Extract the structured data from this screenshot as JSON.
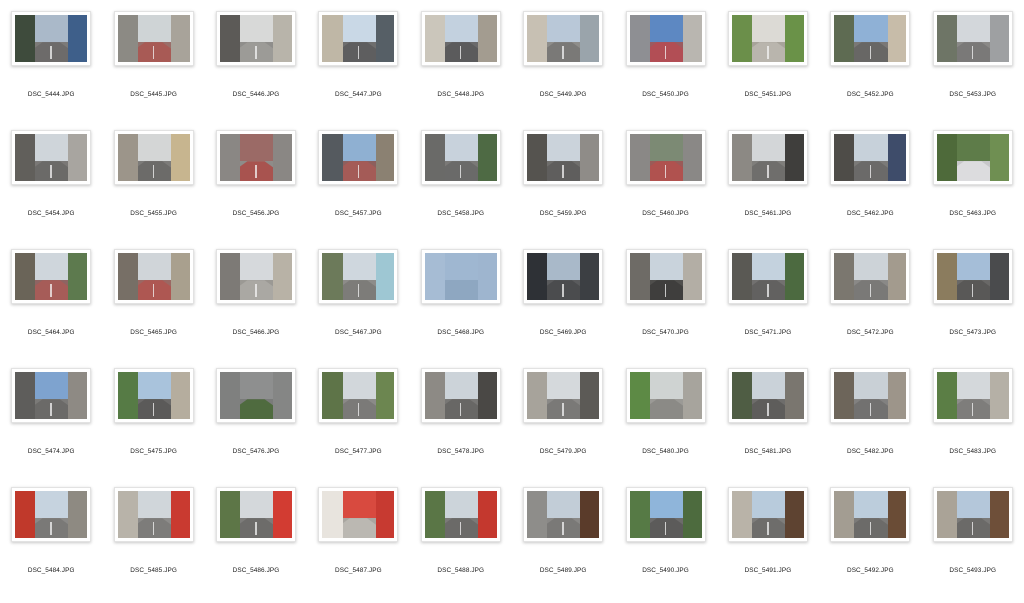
{
  "files": [
    {
      "name": "DSC_5444.JPG",
      "scene": "street",
      "palette": {
        "sky": "#aab9c9",
        "left": "#3e4b3c",
        "right": "#3e5f8a",
        "ground": "#7c7a78",
        "road": "#6d6b6a"
      }
    },
    {
      "name": "DSC_5445.JPG",
      "scene": "street",
      "palette": {
        "sky": "#cfd4d6",
        "left": "#8c8a84",
        "right": "#a8a39a",
        "ground": "#9a6e69",
        "road": "#a85a55"
      }
    },
    {
      "name": "DSC_5446.JPG",
      "scene": "street",
      "palette": {
        "sky": "#d8d9d8",
        "left": "#5c5a57",
        "right": "#b8b4aa",
        "ground": "#8f8e8b",
        "road": "#9c9b97"
      }
    },
    {
      "name": "DSC_5447.JPG",
      "scene": "street",
      "palette": {
        "sky": "#c9d8e6",
        "left": "#bfb7a6",
        "right": "#565f66",
        "ground": "#6e6e6e",
        "road": "#5e5e5f"
      }
    },
    {
      "name": "DSC_5448.JPG",
      "scene": "street",
      "palette": {
        "sky": "#c3d1df",
        "left": "#cbc6bb",
        "right": "#a39c90",
        "ground": "#6a6a6b",
        "road": "#5b5b5c"
      }
    },
    {
      "name": "DSC_5449.JPG",
      "scene": "street",
      "palette": {
        "sky": "#b9c8d8",
        "left": "#c7c0b3",
        "right": "#9aa4ab",
        "ground": "#8e8d8a",
        "road": "#7a7977"
      }
    },
    {
      "name": "DSC_5450.JPG",
      "scene": "street",
      "palette": {
        "sky": "#5d88c2",
        "left": "#8e8f93",
        "right": "#b9b6b0",
        "ground": "#9b5b5f",
        "road": "#b24e55"
      }
    },
    {
      "name": "DSC_5451.JPG",
      "scene": "street",
      "palette": {
        "sky": "#dcdad5",
        "left": "#6b8f4a",
        "right": "#6a9248",
        "ground": "#a7a39a",
        "road": "#b9b5ad"
      }
    },
    {
      "name": "DSC_5452.JPG",
      "scene": "street",
      "palette": {
        "sky": "#8fb1d6",
        "left": "#5e6b52",
        "right": "#c7bca9",
        "ground": "#7a7876",
        "road": "#686765"
      }
    },
    {
      "name": "DSC_5453.JPG",
      "scene": "street",
      "palette": {
        "sky": "#d3d7db",
        "left": "#6e7566",
        "right": "#9ea0a2",
        "ground": "#8a8987",
        "road": "#7a7978"
      }
    },
    {
      "name": "DSC_5454.JPG",
      "scene": "street",
      "palette": {
        "sky": "#cfd5da",
        "left": "#615f5b",
        "right": "#a8a5a0",
        "ground": "#7a7876",
        "road": "#6b6a68"
      }
    },
    {
      "name": "DSC_5455.JPG",
      "scene": "street",
      "palette": {
        "sky": "#d4d6d6",
        "left": "#9c958a",
        "right": "#c7b58f",
        "ground": "#7c7b79",
        "road": "#6c6b69"
      }
    },
    {
      "name": "DSC_5456.JPG",
      "scene": "road",
      "palette": {
        "sky": "#9b6a66",
        "left": "#8a8784",
        "right": "#8a8784",
        "ground": "#8e8c89",
        "road": "#a8534f"
      }
    },
    {
      "name": "DSC_5457.JPG",
      "scene": "street",
      "palette": {
        "sky": "#8fb0d2",
        "left": "#555a5f",
        "right": "#8b8172",
        "ground": "#8d5f5d",
        "road": "#a45b57"
      }
    },
    {
      "name": "DSC_5458.JPG",
      "scene": "street",
      "palette": {
        "sky": "#c8d2dc",
        "left": "#6a6a68",
        "right": "#4e6a44",
        "ground": "#7a7977",
        "road": "#6a6a69"
      }
    },
    {
      "name": "DSC_5459.JPG",
      "scene": "street",
      "palette": {
        "sky": "#cbd3db",
        "left": "#55534f",
        "right": "#8f8c88",
        "ground": "#6f6e6c",
        "road": "#5f5e5d"
      }
    },
    {
      "name": "DSC_5460.JPG",
      "scene": "road",
      "palette": {
        "sky": "#7c8a74",
        "left": "#8a8886",
        "right": "#8a8886",
        "ground": "#9a5b58",
        "road": "#b0524f"
      }
    },
    {
      "name": "DSC_5461.JPG",
      "scene": "street",
      "palette": {
        "sky": "#d3d6d8",
        "left": "#8c8984",
        "right": "#3f3e3c",
        "ground": "#7f7e7b",
        "road": "#6f6e6c"
      }
    },
    {
      "name": "DSC_5462.JPG",
      "scene": "street",
      "palette": {
        "sky": "#c7d1da",
        "left": "#4e4c48",
        "right": "#3e4c6a",
        "ground": "#7b7a78",
        "road": "#6b6a69"
      }
    },
    {
      "name": "DSC_5463.JPG",
      "scene": "plants",
      "palette": {
        "sky": "#5e7c49",
        "left": "#4e6a3a",
        "right": "#6f8f52",
        "ground": "#c7c7c9",
        "road": "#dcdcde"
      }
    },
    {
      "name": "DSC_5464.JPG",
      "scene": "street",
      "palette": {
        "sky": "#cfd6dc",
        "left": "#6a6458",
        "right": "#5d7a4e",
        "ground": "#8e6462",
        "road": "#a65c58"
      }
    },
    {
      "name": "DSC_5465.JPG",
      "scene": "street",
      "palette": {
        "sky": "#d0d5d9",
        "left": "#776f66",
        "right": "#a9a08e",
        "ground": "#9a6863",
        "road": "#ae5752"
      }
    },
    {
      "name": "DSC_5466.JPG",
      "scene": "street",
      "palette": {
        "sky": "#d6d9dc",
        "left": "#7d7a76",
        "right": "#b8b2a6",
        "ground": "#9b9994",
        "road": "#aaa8a3"
      }
    },
    {
      "name": "DSC_5467.JPG",
      "scene": "street",
      "palette": {
        "sky": "#cfd7de",
        "left": "#6c7a5a",
        "right": "#9ec7d3",
        "ground": "#8d8c89",
        "road": "#7d7c79"
      }
    },
    {
      "name": "DSC_5468.JPG",
      "scene": "sky",
      "palette": {
        "sky": "#9fb7d1",
        "left": "#a6bcd4",
        "right": "#9eb5cf",
        "ground": "#8ea7c1",
        "road": "#8ea7c1"
      }
    },
    {
      "name": "DSC_5469.JPG",
      "scene": "street",
      "palette": {
        "sky": "#a9b9c9",
        "left": "#2e3136",
        "right": "#3c3f43",
        "ground": "#5a5b5d",
        "road": "#4b4c4e"
      }
    },
    {
      "name": "DSC_5470.JPG",
      "scene": "street",
      "palette": {
        "sky": "#c9d3dc",
        "left": "#6e6b66",
        "right": "#b3aea5",
        "ground": "#4f4e4c",
        "road": "#3f3e3d"
      }
    },
    {
      "name": "DSC_5471.JPG",
      "scene": "street",
      "palette": {
        "sky": "#c4d2de",
        "left": "#5a5954",
        "right": "#4c6a40",
        "ground": "#727170",
        "road": "#626160"
      }
    },
    {
      "name": "DSC_5472.JPG",
      "scene": "street",
      "palette": {
        "sky": "#cdd3d8",
        "left": "#7b776f",
        "right": "#a39b8e",
        "ground": "#8a8987",
        "road": "#7a7977"
      }
    },
    {
      "name": "DSC_5473.JPG",
      "scene": "street",
      "palette": {
        "sky": "#a5bed8",
        "left": "#8b7c5e",
        "right": "#4a4b4d",
        "ground": "#696867",
        "road": "#595857"
      }
    },
    {
      "name": "DSC_5474.JPG",
      "scene": "street",
      "palette": {
        "sky": "#7ea3cf",
        "left": "#5e5d5b",
        "right": "#8e8a84",
        "ground": "#7b7a78",
        "road": "#6b6a68"
      }
    },
    {
      "name": "DSC_5475.JPG",
      "scene": "street",
      "palette": {
        "sky": "#a9c3dc",
        "left": "#567b45",
        "right": "#b5ad9e",
        "ground": "#6b6a69",
        "road": "#5b5a59"
      }
    },
    {
      "name": "DSC_5476.JPG",
      "scene": "wall",
      "palette": {
        "sky": "#8e8f8f",
        "left": "#7f807f",
        "right": "#858685",
        "ground": "#7a7b7a",
        "road": "#4f6b3f"
      }
    },
    {
      "name": "DSC_5477.JPG",
      "scene": "street",
      "palette": {
        "sky": "#d2d7db",
        "left": "#5e7448",
        "right": "#6c8650",
        "ground": "#8b8a88",
        "road": "#7b7a78"
      }
    },
    {
      "name": "DSC_5478.JPG",
      "scene": "street",
      "palette": {
        "sky": "#ccd3d9",
        "left": "#8d8a85",
        "right": "#4a4845",
        "ground": "#787775",
        "road": "#686765"
      }
    },
    {
      "name": "DSC_5479.JPG",
      "scene": "street",
      "palette": {
        "sky": "#d5d9dc",
        "left": "#a7a39b",
        "right": "#5c5a56",
        "ground": "#8a8987",
        "road": "#7a7977"
      }
    },
    {
      "name": "DSC_5480.JPG",
      "scene": "plants",
      "palette": {
        "sky": "#cfd3d2",
        "left": "#5d8a45",
        "right": "#a7a49d",
        "ground": "#9b9a96",
        "road": "#8b8a86"
      }
    },
    {
      "name": "DSC_5481.JPG",
      "scene": "street",
      "palette": {
        "sky": "#cad2d9",
        "left": "#4f5d44",
        "right": "#7a766f",
        "ground": "#6e6d6b",
        "road": "#5e5d5b"
      }
    },
    {
      "name": "DSC_5482.JPG",
      "scene": "street",
      "palette": {
        "sky": "#c9d0d6",
        "left": "#6d655a",
        "right": "#9d958a",
        "ground": "#828180",
        "road": "#727170"
      }
    },
    {
      "name": "DSC_5483.JPG",
      "scene": "street",
      "palette": {
        "sky": "#d4d8db",
        "left": "#5b7e45",
        "right": "#b5b0a6",
        "ground": "#8e8d8b",
        "road": "#7e7d7b"
      }
    },
    {
      "name": "DSC_5484.JPG",
      "scene": "street",
      "palette": {
        "sky": "#c6d3df",
        "left": "#c0392b",
        "right": "#8e8a82",
        "ground": "#8a8987",
        "road": "#7a7977"
      }
    },
    {
      "name": "DSC_5485.JPG",
      "scene": "street",
      "palette": {
        "sky": "#d0d6da",
        "left": "#b8b3a9",
        "right": "#c93a30",
        "ground": "#8d8c8a",
        "road": "#7d7c7a"
      }
    },
    {
      "name": "DSC_5486.JPG",
      "scene": "street",
      "palette": {
        "sky": "#d4d8db",
        "left": "#5d7647",
        "right": "#d23c32",
        "ground": "#7d7c7a",
        "road": "#6d6c6a"
      }
    },
    {
      "name": "DSC_5487.JPG",
      "scene": "vending",
      "palette": {
        "sky": "#d84a3f",
        "left": "#e8e4de",
        "right": "#c73a31",
        "ground": "#a9a6a0",
        "road": "#bbb8b2"
      }
    },
    {
      "name": "DSC_5488.JPG",
      "scene": "street",
      "palette": {
        "sky": "#ccd4da",
        "left": "#5a7646",
        "right": "#c4382e",
        "ground": "#7b7a78",
        "road": "#6b6a68"
      }
    },
    {
      "name": "DSC_5489.JPG",
      "scene": "street",
      "palette": {
        "sky": "#c2cdd7",
        "left": "#8e8d8a",
        "right": "#5a3b2a",
        "ground": "#8a8987",
        "road": "#7a7977"
      }
    },
    {
      "name": "DSC_5490.JPG",
      "scene": "street",
      "palette": {
        "sky": "#8fb5da",
        "left": "#567a45",
        "right": "#4d6b3e",
        "ground": "#6c6b6a",
        "road": "#5c5b5a"
      }
    },
    {
      "name": "DSC_5491.JPG",
      "scene": "street",
      "palette": {
        "sky": "#b8cbdc",
        "left": "#b9b3a8",
        "right": "#5e4331",
        "ground": "#7e7d7b",
        "road": "#6e6d6b"
      }
    },
    {
      "name": "DSC_5492.JPG",
      "scene": "street",
      "palette": {
        "sky": "#bccddc",
        "left": "#a39d92",
        "right": "#6a4c36",
        "ground": "#7c7b79",
        "road": "#6c6b69"
      }
    },
    {
      "name": "DSC_5493.JPG",
      "scene": "street",
      "palette": {
        "sky": "#b4c7da",
        "left": "#aaa397",
        "right": "#6e4f39",
        "ground": "#7b7a78",
        "road": "#6b6a68"
      }
    }
  ]
}
